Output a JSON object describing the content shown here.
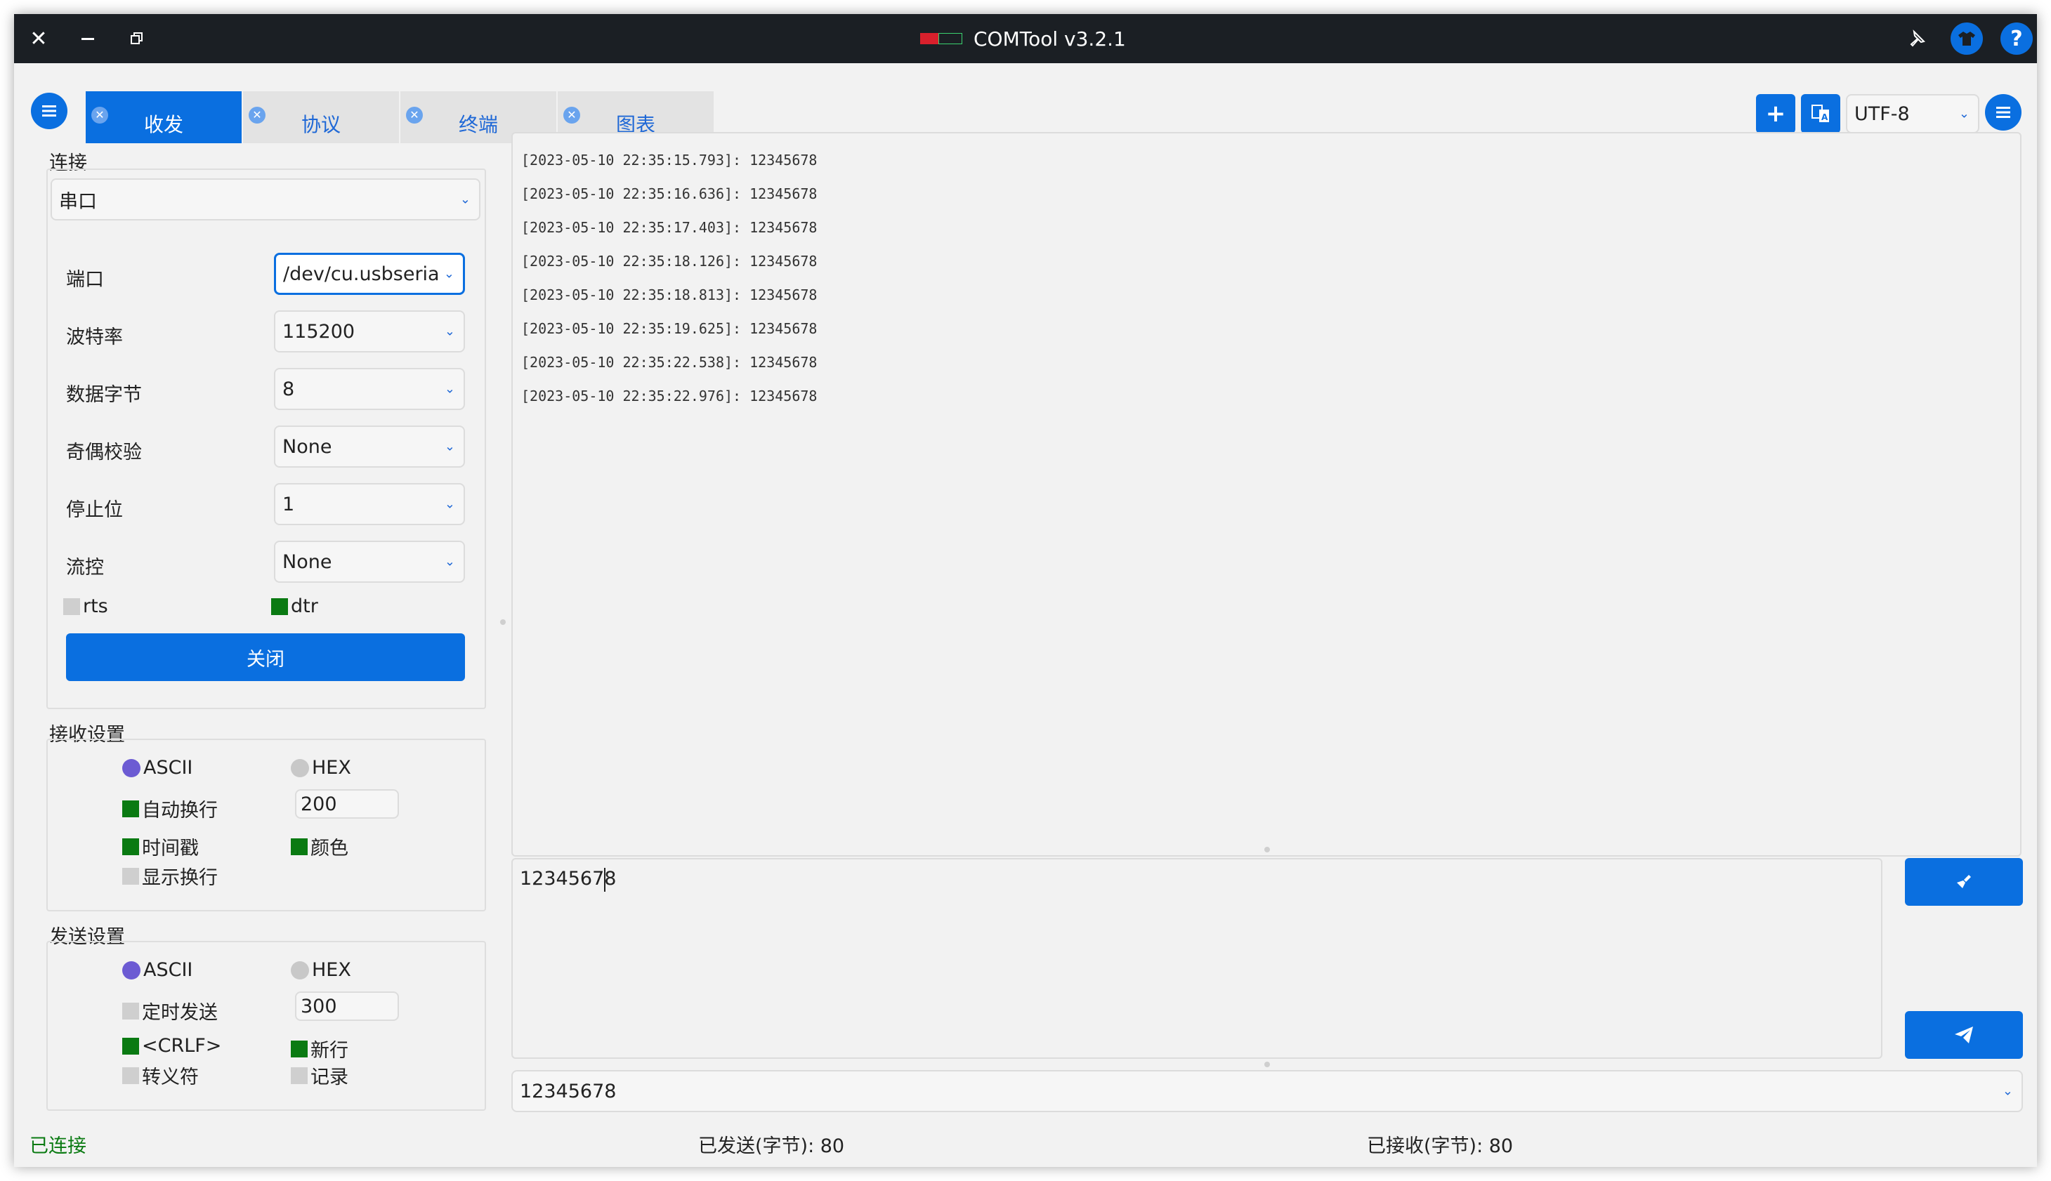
{
  "titlebar": {
    "title": "COMTool v3.2.1",
    "close_icon": "close-icon",
    "minimize_icon": "minimize-icon",
    "restore_icon": "restore-icon",
    "pin_icon": "pin-icon",
    "skin_icon": "tshirt-icon",
    "help_label": "?"
  },
  "tabs": [
    {
      "label": "收发",
      "active": true
    },
    {
      "label": "协议",
      "active": false
    },
    {
      "label": "终端",
      "active": false
    },
    {
      "label": "图表",
      "active": false
    }
  ],
  "toolbar": {
    "add_label": "+",
    "encoding": "UTF-8"
  },
  "connection": {
    "section_label": "连接",
    "type": "串口",
    "fields": [
      {
        "label": "端口",
        "value": "/dev/cu.usbseria"
      },
      {
        "label": "波特率",
        "value": "115200"
      },
      {
        "label": "数据字节",
        "value": "8"
      },
      {
        "label": "奇偶校验",
        "value": "None"
      },
      {
        "label": "停止位",
        "value": "1"
      },
      {
        "label": "流控",
        "value": "None"
      }
    ],
    "rts_label": "rts",
    "rts_checked": false,
    "dtr_label": "dtr",
    "dtr_checked": true,
    "close_button": "关闭"
  },
  "receive_settings": {
    "section_label": "接收设置",
    "ascii_label": "ASCII",
    "hex_label": "HEX",
    "auto_wrap_label": "自动换行",
    "auto_wrap_value": "200",
    "timestamp_label": "时间戳",
    "color_label": "颜色",
    "show_newline_label": "显示换行"
  },
  "send_settings": {
    "section_label": "发送设置",
    "ascii_label": "ASCII",
    "hex_label": "HEX",
    "timer_label": "定时发送",
    "timer_value": "300",
    "crlf_label": "<CRLF>",
    "newline_label": "新行",
    "escape_label": "转义符",
    "record_label": "记录"
  },
  "receive_log": [
    "[2023-05-10 22:35:15.793]: 12345678",
    "[2023-05-10 22:35:16.636]: 12345678",
    "[2023-05-10 22:35:17.403]: 12345678",
    "[2023-05-10 22:35:18.126]: 12345678",
    "[2023-05-10 22:35:18.813]: 12345678",
    "[2023-05-10 22:35:19.625]: 12345678",
    "[2023-05-10 22:35:22.538]: 12345678",
    "[2023-05-10 22:35:22.976]: 12345678"
  ],
  "send": {
    "text": "12345678",
    "history_value": "12345678",
    "clear_icon": "broom-icon",
    "send_icon": "paper-plane-icon"
  },
  "status": {
    "connected": "已连接",
    "sent": "已发送(字节): 80",
    "received": "已接收(字节): 80"
  },
  "colors": {
    "accent": "#0a6fe0",
    "checked": "#0a7a12",
    "radio": "#6c5bd3",
    "status_ok": "#0a7a12"
  }
}
